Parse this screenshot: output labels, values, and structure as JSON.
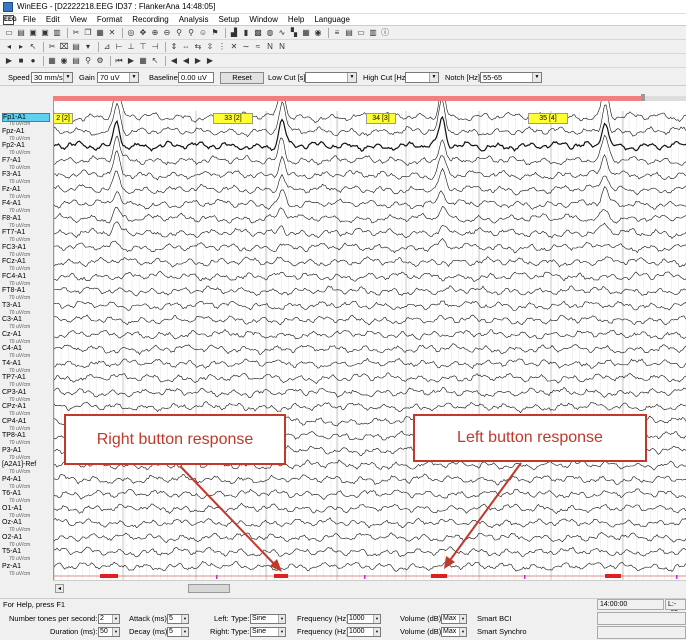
{
  "window": {
    "title": "WinEEG - [D2222218.EEG ID37 : FlankerAna 14:48:05]",
    "app_icon_label": "EEG"
  },
  "menu": [
    "File",
    "Edit",
    "View",
    "Format",
    "Recording",
    "Analysis",
    "Setup",
    "Window",
    "Help",
    "Language"
  ],
  "controls": {
    "speed_label": "Speed",
    "speed_value": "30 mm/s",
    "gain_label": "Gain",
    "gain_value": "70 uV",
    "baseline_label": "Baseline",
    "baseline_value": "0.00 uV",
    "reset_label": "Reset",
    "lowcut_label": "Low Cut [s]",
    "lowcut_value": "",
    "highcut_label": "High Cut [Hz]",
    "highcut_value": "",
    "notch_label": "Notch [Hz]",
    "notch_value": "55-65"
  },
  "ruler_ticks": [
    "143",
    "144",
    "145",
    "146",
    "147",
    "148",
    "149",
    "150",
    "151"
  ],
  "events": [
    {
      "label": "2 [2]"
    },
    {
      "label": "33 [2]"
    },
    {
      "label": "34 [3]"
    },
    {
      "label": "35 [4]"
    }
  ],
  "channels": [
    "Fp1-A1",
    "Fpz-A1",
    "Fp2-A1",
    "F7-A1",
    "F3-A1",
    "Fz-A1",
    "F4-A1",
    "F8-A1",
    "FT7-A1",
    "FC3-A1",
    "FCz-A1",
    "FC4-A1",
    "FT8-A1",
    "T3-A1",
    "C3-A1",
    "Cz-A1",
    "C4-A1",
    "T4-A1",
    "TP7-A1",
    "CP3-A1",
    "CPz-A1",
    "CP4-A1",
    "TP8-A1",
    "P3-A1",
    "[A2A1]-Ref",
    "P4-A1",
    "T6-A1",
    "O1-A1",
    "Oz-A1",
    "O2-A1",
    "T5-A1",
    "Pz-A1"
  ],
  "channel_scale": "70 uV/cm",
  "annotations": {
    "right": "Right button response",
    "left": "Left button response"
  },
  "colors": {
    "annotation": "#c0392b",
    "highlight": "#5fd0f0",
    "marker": "#ffff33",
    "response": "#e02020"
  },
  "status": {
    "help": "For Help, press F1",
    "time": "14:00:00",
    "right": "L:- -65"
  },
  "stim": {
    "tones_label": "Number tones per second:",
    "tones_value": "2",
    "duration_label": "Duration (ms):",
    "duration_value": "50",
    "attack_label": "Attack (ms):",
    "attack_value": "5",
    "decay_label": "Decay (ms):",
    "decay_value": "5",
    "left_label": "Left:",
    "right_label": "Right:",
    "type_label": "Type:",
    "left_type": "Sine",
    "right_type": "Sine",
    "freq_label": "Frequency (Hz):",
    "left_freq": "1000",
    "right_freq": "1000",
    "vol_label": "Volume (dB):",
    "left_vol": "Max",
    "right_vol": "Max",
    "smart_bci": "Smart BCI",
    "smart_synchro": "Smart Synchro"
  }
}
